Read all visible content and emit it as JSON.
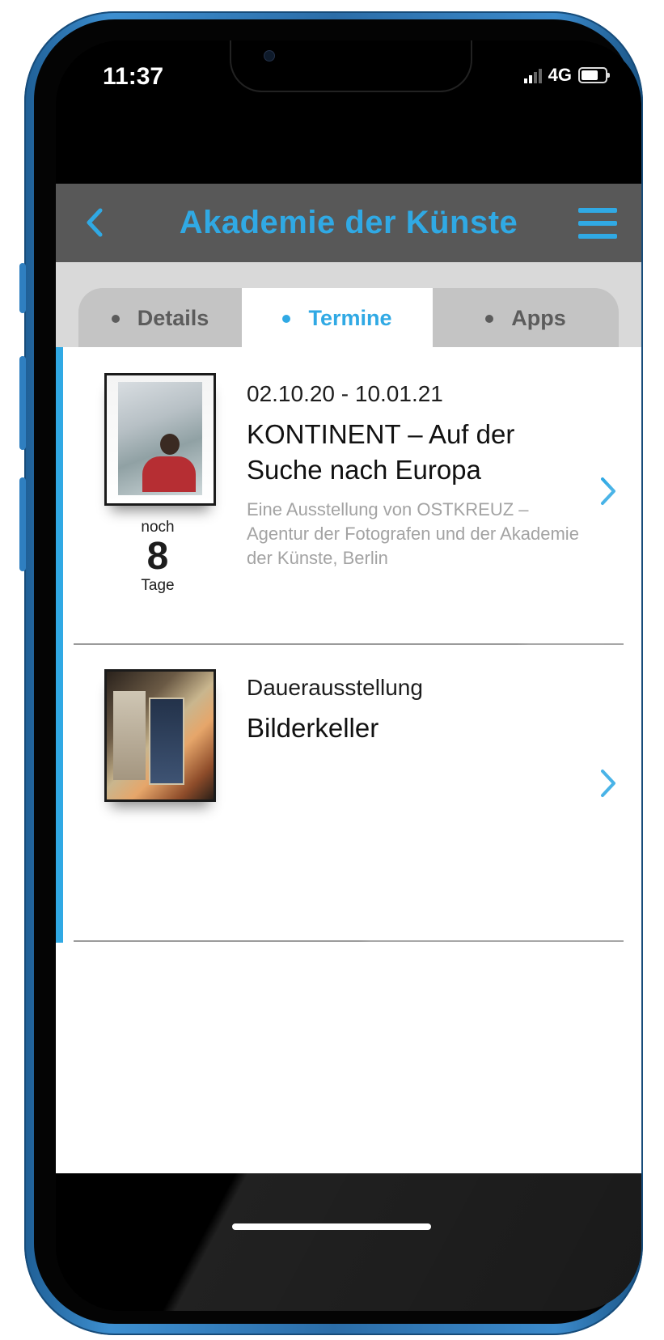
{
  "status_bar": {
    "time": "11:37",
    "network": "4G",
    "icons": [
      "signal-icon",
      "battery-icon"
    ]
  },
  "navbar": {
    "title": "Akademie der Künste",
    "back_icon": "chevron-left-icon",
    "menu_icon": "hamburger-menu-icon"
  },
  "tabs": [
    {
      "label": "Details",
      "active": false
    },
    {
      "label": "Termine",
      "active": true
    },
    {
      "label": "Apps",
      "active": false
    }
  ],
  "events": [
    {
      "date": "02.10.20 - 10.01.21",
      "title": "KONTINENT – Auf der Suche nach Europa",
      "description": "Eine Ausstellung von OSTKREUZ – Agentur der Fotografen und der Akademie der Künste, Berlin",
      "countdown": {
        "prefix": "noch",
        "value": "8",
        "unit": "Tage"
      }
    },
    {
      "date": "Dauerausstellung",
      "title": "Bilderkeller"
    }
  ],
  "colors": {
    "accent": "#30a9e4",
    "navbar": "#585858",
    "tab_bg": "#c4c4c4",
    "frame": "#2f7fc0"
  }
}
